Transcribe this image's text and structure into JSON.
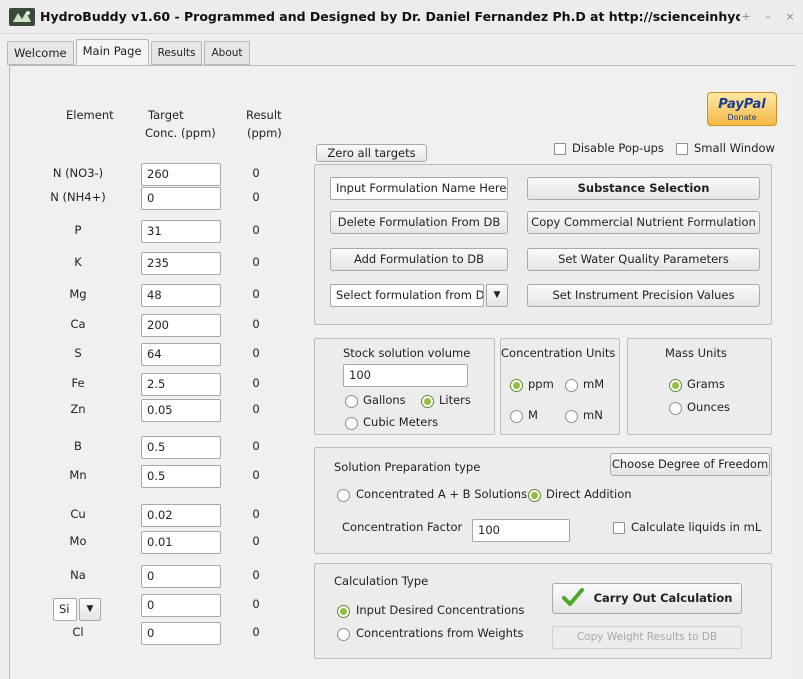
{
  "window": {
    "title": "HydroBuddy v1.60 - Programmed and Designed by Dr. Daniel Fernandez Ph.D at http://scienceinhydroponic",
    "controls": [
      "+",
      "–",
      "×"
    ]
  },
  "tabs": [
    {
      "label": "Welcome",
      "active": false
    },
    {
      "label": "Main Page",
      "active": true
    },
    {
      "label": "Results",
      "active": false
    },
    {
      "label": "About",
      "active": false
    }
  ],
  "paypal": {
    "brand": "PayPal",
    "donate": "Donate"
  },
  "headers": {
    "element": "Element",
    "target_line1": "Target",
    "target_line2": "Conc. (ppm)",
    "result_line1": "Result",
    "result_line2": "(ppm)"
  },
  "elements": [
    {
      "name": "N (NO3-)",
      "target": "260",
      "result": "0"
    },
    {
      "name": "N (NH4+)",
      "target": "0",
      "result": "0"
    },
    {
      "name": "P",
      "target": "31",
      "result": "0"
    },
    {
      "name": "K",
      "target": "235",
      "result": "0"
    },
    {
      "name": "Mg",
      "target": "48",
      "result": "0"
    },
    {
      "name": "Ca",
      "target": "200",
      "result": "0"
    },
    {
      "name": "S",
      "target": "64",
      "result": "0"
    },
    {
      "name": "Fe",
      "target": "2.5",
      "result": "0"
    },
    {
      "name": "Zn",
      "target": "0.05",
      "result": "0"
    },
    {
      "name": "B",
      "target": "0.5",
      "result": "0"
    },
    {
      "name": "Mn",
      "target": "0.5",
      "result": "0"
    },
    {
      "name": "Cu",
      "target": "0.02",
      "result": "0"
    },
    {
      "name": "Mo",
      "target": "0.01",
      "result": "0"
    },
    {
      "name": "Na",
      "target": "0",
      "result": "0"
    },
    {
      "name": "Si",
      "target": "0",
      "result": "0"
    },
    {
      "name": "Cl",
      "target": "0",
      "result": "0"
    }
  ],
  "si_selector": {
    "value": "Si"
  },
  "top_controls": {
    "zero_all": "Zero all targets",
    "disable_popups": "Disable Pop-ups",
    "small_window": "Small Window"
  },
  "formulation": {
    "name_input": "Input Formulation Name Here",
    "substance_selection": "Substance Selection",
    "delete": "Delete Formulation From DB",
    "copy_commercial": "Copy Commercial Nutrient Formulation",
    "add": "Add Formulation to DB",
    "water_quality": "Set Water Quality Parameters",
    "select_db": "Select formulation from DB",
    "instrument_precision": "Set Instrument Precision Values"
  },
  "stock": {
    "title": "Stock solution volume",
    "value": "100",
    "gallons": "Gallons",
    "liters": "Liters",
    "cubic_meters": "Cubic Meters",
    "selected": "liters"
  },
  "conc_units": {
    "title": "Concentration Units",
    "ppm": "ppm",
    "mM": "mM",
    "M": "M",
    "mN": "mN",
    "selected": "ppm"
  },
  "mass_units": {
    "title": "Mass Units",
    "grams": "Grams",
    "ounces": "Ounces",
    "selected": "grams"
  },
  "prep": {
    "title": "Solution Preparation type",
    "degree_of_freedom": "Choose Degree of Freedom",
    "concentrated": "Concentrated A + B Solutions",
    "direct": "Direct Addition",
    "selected": "direct",
    "factor_label": "Concentration Factor",
    "factor_value": "100",
    "liquids_ml": "Calculate liquids in mL"
  },
  "calc": {
    "title": "Calculation Type",
    "carry_out": "Carry Out Calculation",
    "input_desired": "Input Desired Concentrations",
    "from_weights": "Concentrations from  Weights",
    "copy_weights": "Copy Weight Results to DB",
    "selected": "input_desired"
  },
  "colors": {
    "radio_selected": "#8cbf3f",
    "check_mark": "#4ea62a",
    "paypal_gold": "#f6b843",
    "paypal_blue": "#1a3d8f"
  }
}
